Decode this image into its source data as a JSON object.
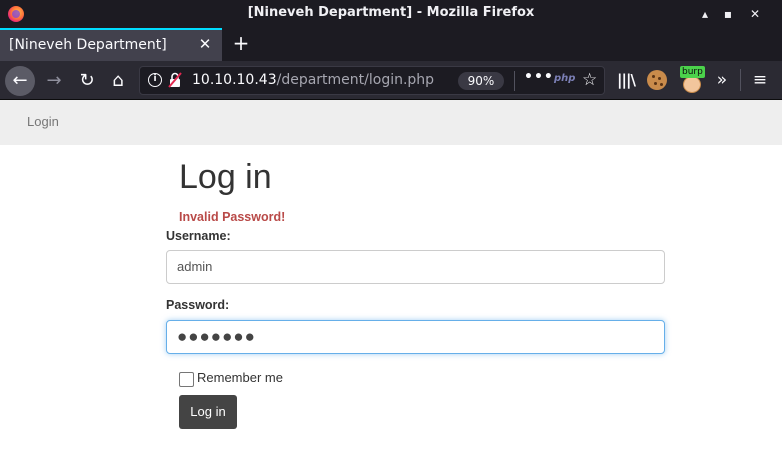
{
  "window": {
    "title": "[Nineveh Department] - Mozilla Firefox",
    "controls": {
      "minimize": "▴",
      "maximize": "▪",
      "close": "✕"
    }
  },
  "tabs": [
    {
      "label": "[Nineveh Department]",
      "active": true,
      "close": "✕"
    }
  ],
  "new_tab": "+",
  "navigation": {
    "back": "←",
    "forward": "→",
    "reload": "↻",
    "home": "⌂",
    "url_host": "10.10.10.43",
    "url_path": "/department/login.php",
    "zoom": "90%",
    "page_actions": "•••",
    "php_badge": "php",
    "bookmark": "☆"
  },
  "toolbar": {
    "library": "|||\\",
    "burp_badge": "burp",
    "overflow": "»",
    "menu": "≡"
  },
  "site": {
    "nav_link": "Login"
  },
  "login": {
    "heading": "Log in",
    "error": "Invalid Password!",
    "username_label": "Username:",
    "username_value": "admin",
    "password_label": "Password:",
    "password_masked": "●●●●●●●",
    "remember_label": "Remember me",
    "remember_checked": false,
    "submit_label": "Log in"
  },
  "colors": {
    "error": "#b94a48",
    "focus_border": "#66afe9",
    "button": "#444444",
    "tab_accent": "#00ddff"
  }
}
